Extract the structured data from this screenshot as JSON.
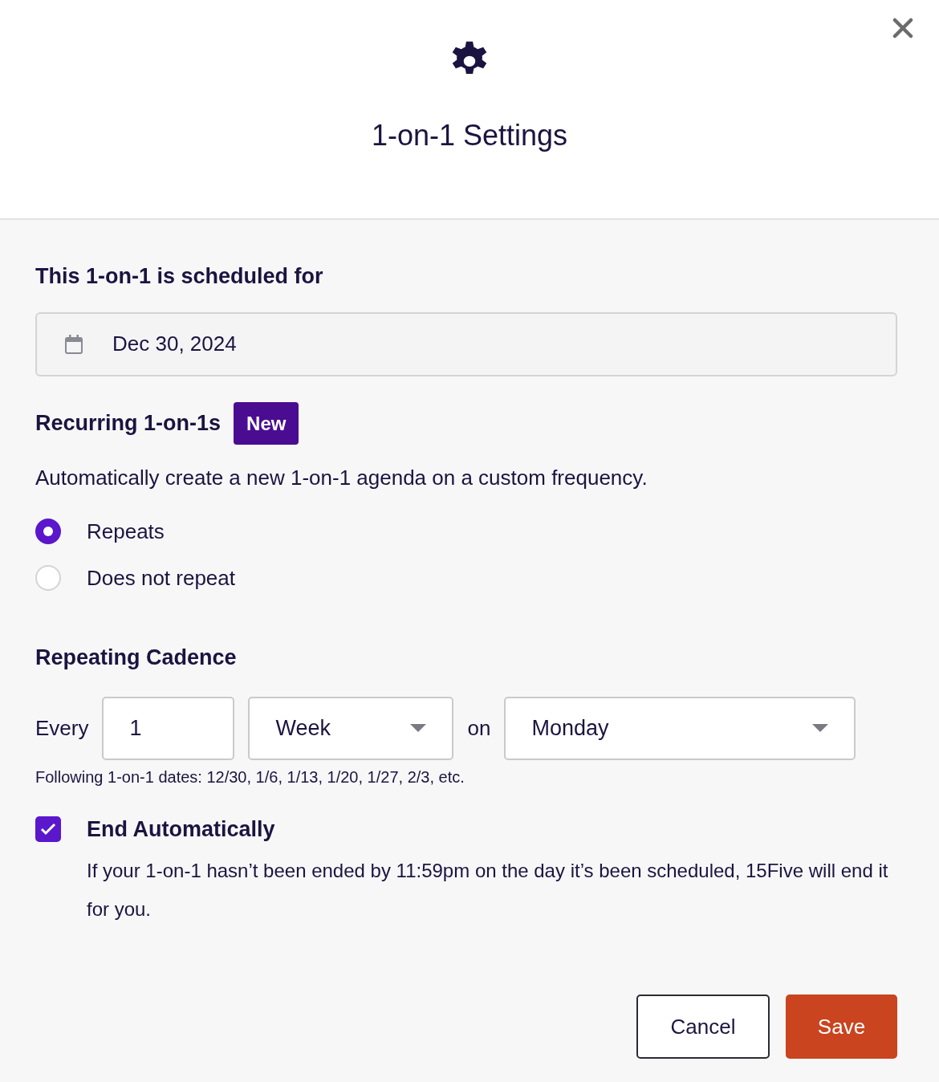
{
  "dialog": {
    "title": "1-on-1 Settings"
  },
  "schedule": {
    "label": "This 1-on-1 is scheduled for",
    "date": "Dec 30, 2024"
  },
  "recurring": {
    "heading": "Recurring 1-on-1s",
    "badge": "New",
    "description": "Automatically create a new 1-on-1 agenda on a custom frequency.",
    "options": [
      {
        "label": "Repeats",
        "selected": true
      },
      {
        "label": "Does not repeat",
        "selected": false
      }
    ]
  },
  "cadence": {
    "heading": "Repeating Cadence",
    "every_label": "Every",
    "interval": "1",
    "unit": "Week",
    "on_label": "on",
    "day": "Monday",
    "following_dates": "Following 1-on-1 dates: 12/30, 1/6, 1/13, 1/20, 1/27, 2/3, etc."
  },
  "end_automatically": {
    "label": "End Automatically",
    "checked": true,
    "description": "If your 1-on-1 hasn’t been ended by 11:59pm on the day it’s been scheduled, 15Five will end it for you."
  },
  "buttons": [
    {
      "label": "Cancel",
      "kind": "secondary"
    },
    {
      "label": "Save",
      "kind": "primary"
    }
  ]
}
